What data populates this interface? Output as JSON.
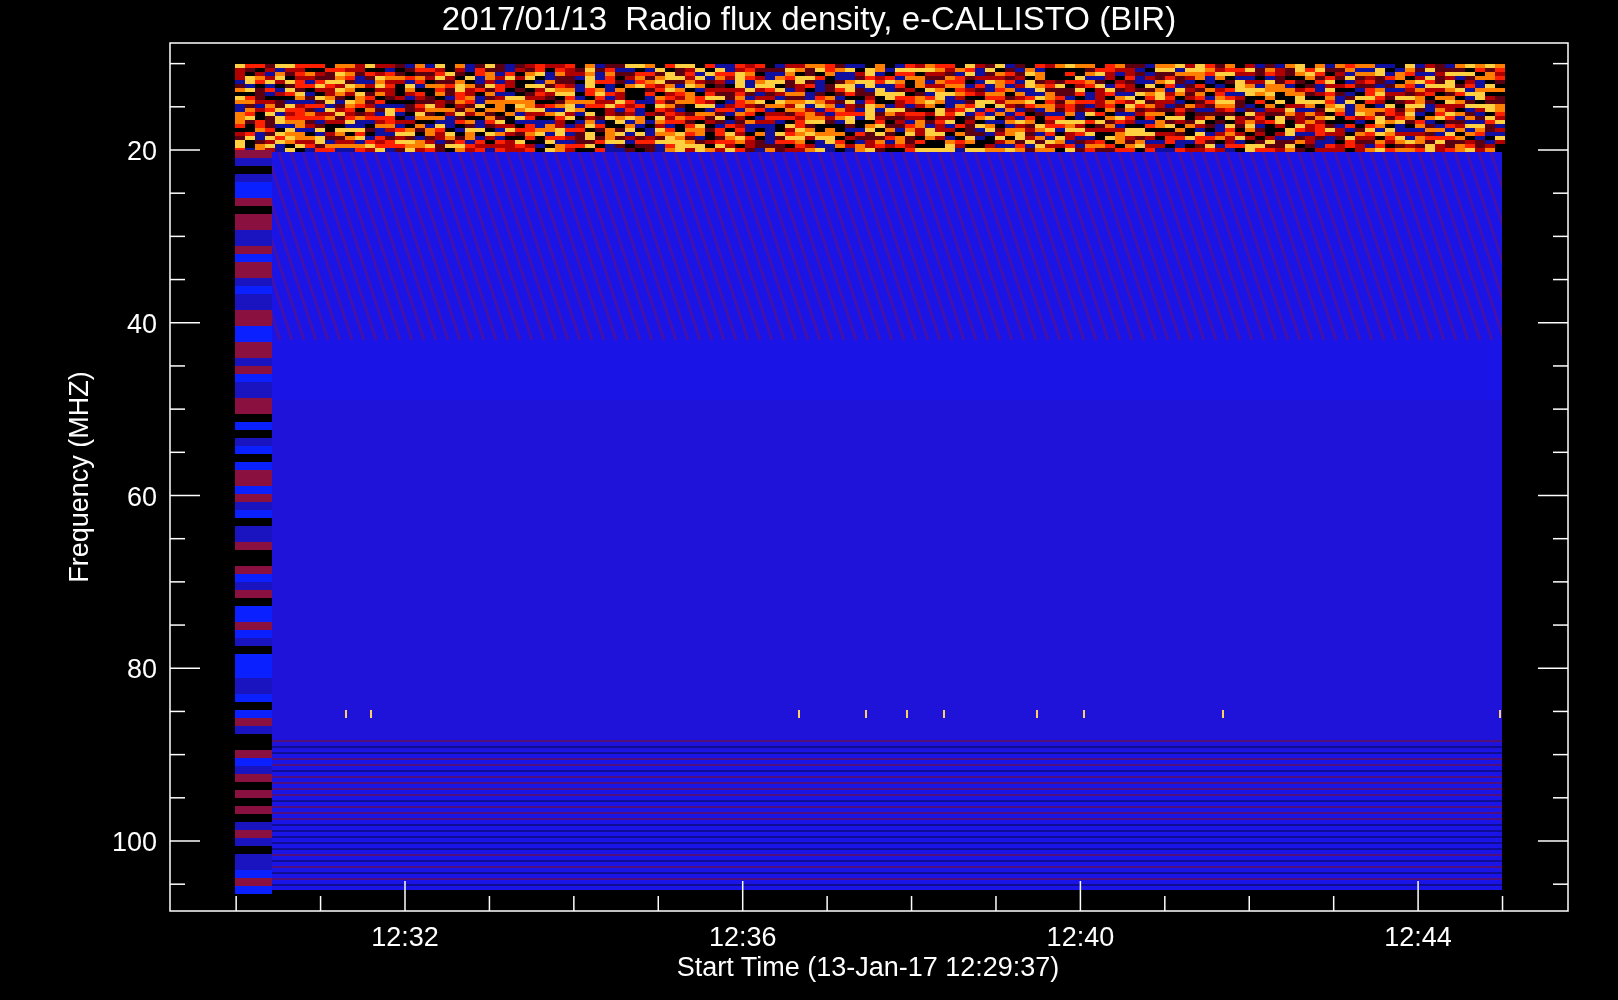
{
  "title": "2017/01/13  Radio flux density, e-CALLISTO (BIR)",
  "ylabel": "Frequency (MHZ)",
  "xlabel": "Start Time (13-Jan-17 12:29:37)",
  "yticks": [
    "20",
    "40",
    "60",
    "80",
    "100"
  ],
  "xticks": [
    "12:32",
    "12:36",
    "12:40",
    "12:44"
  ]
}
